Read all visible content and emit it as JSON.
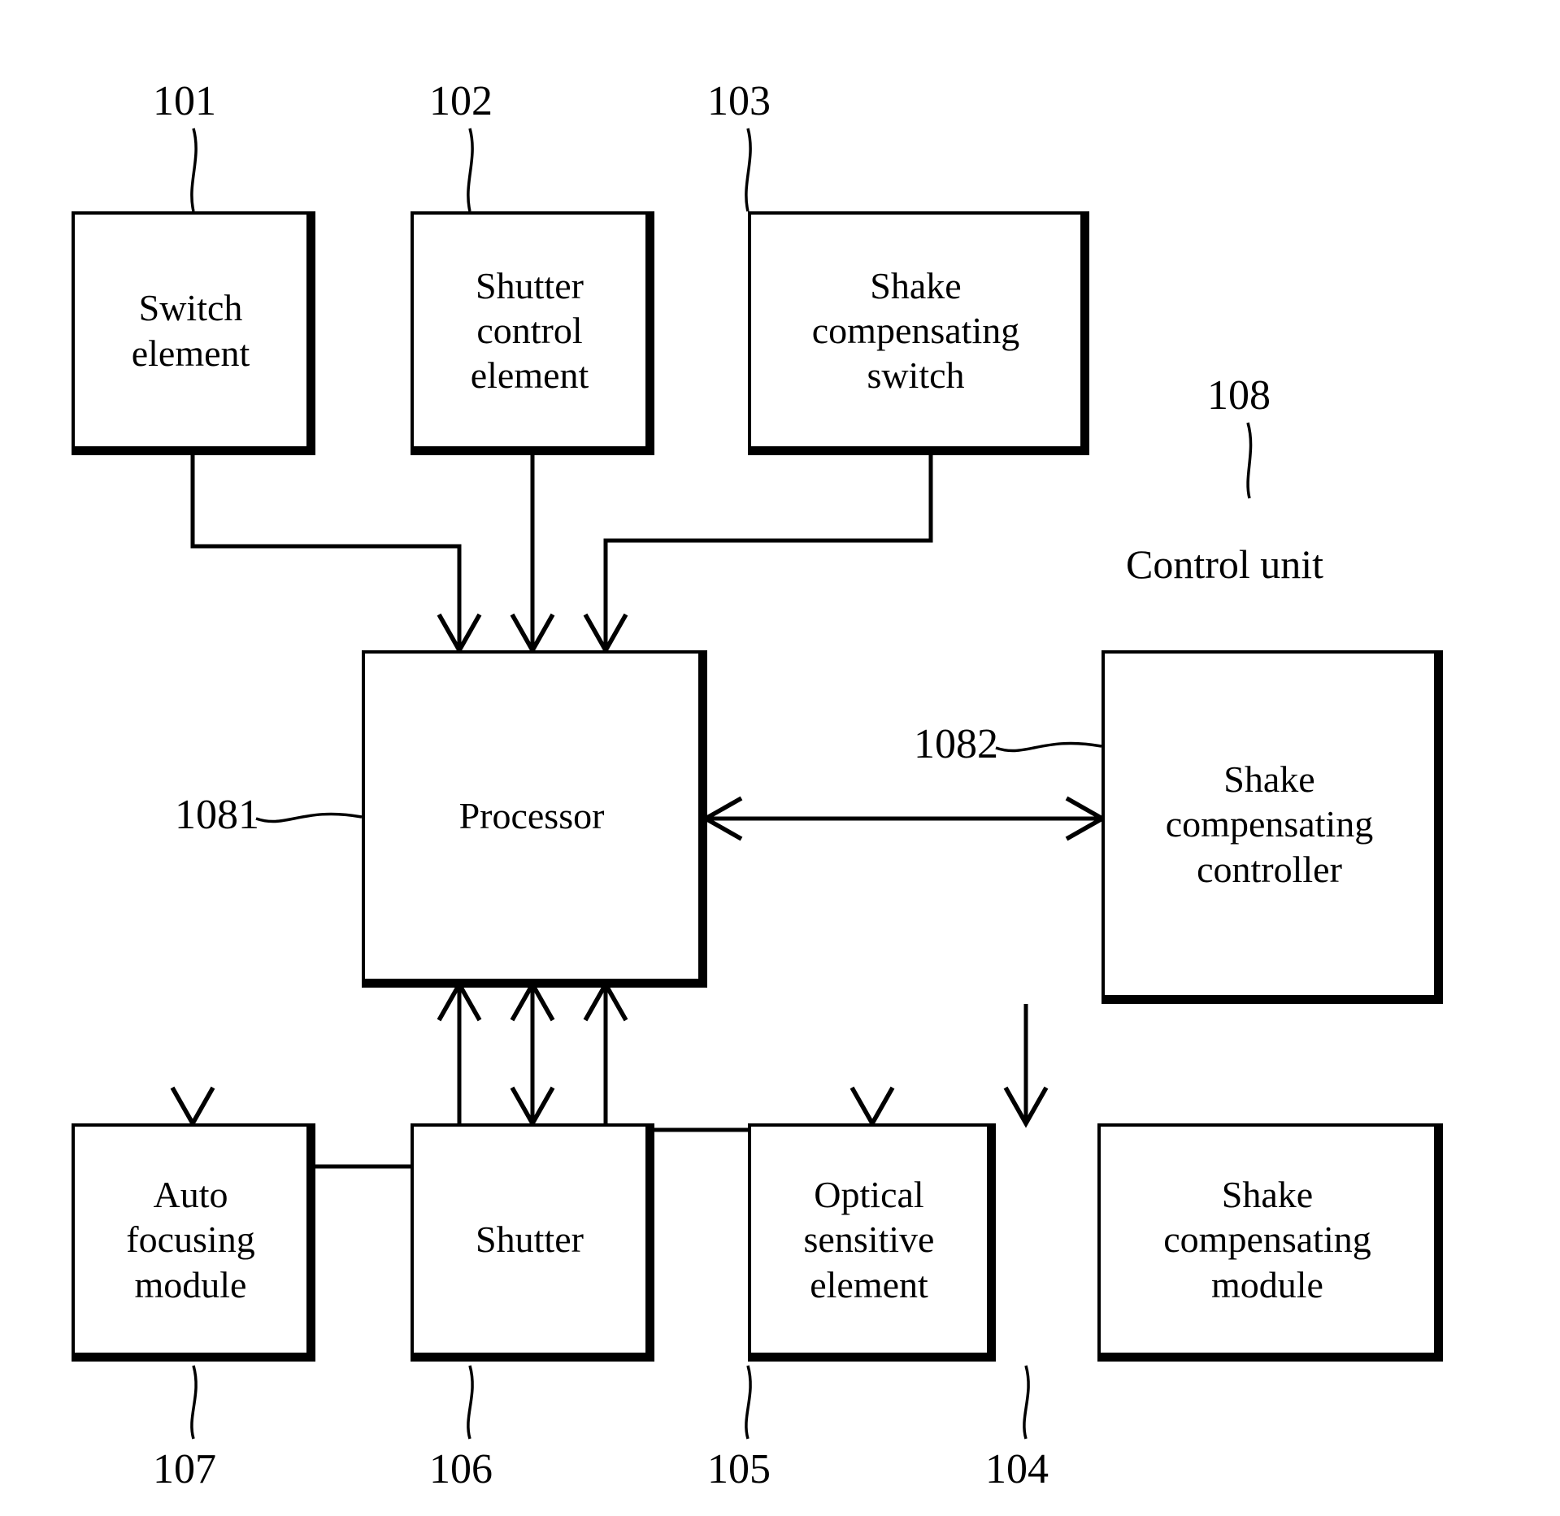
{
  "figure": {
    "type": "patent-block-diagram",
    "title": "Camera control block diagram"
  },
  "blocks": [
    {
      "id": "switch-element",
      "label": "Switch\nelement",
      "ref": "101"
    },
    {
      "id": "shutter-control-element",
      "label": "Shutter\ncontrol\nelement",
      "ref": "102"
    },
    {
      "id": "shake-compensating-switch",
      "label": "Shake\ncompensating\nswitch",
      "ref": "103"
    },
    {
      "id": "processor",
      "label": "Processor",
      "ref": "1081"
    },
    {
      "id": "shake-compensating-controller",
      "label": "Shake\ncompensating\ncontroller",
      "ref": "1082"
    },
    {
      "id": "auto-focusing-module",
      "label": "Auto\nfocusing\nmodule",
      "ref": "107"
    },
    {
      "id": "shutter",
      "label": "Shutter",
      "ref": "106"
    },
    {
      "id": "optical-sensitive-element",
      "label": "Optical\nsensitive\nelement",
      "ref": "105"
    },
    {
      "id": "shake-compensating-module",
      "label": "Shake\ncompensating\nmodule",
      "ref": "104"
    }
  ],
  "control_unit": {
    "label": "Control unit",
    "ref": "108",
    "contains": [
      "processor",
      "shake-compensating-controller"
    ]
  },
  "labels": {
    "switch_element": "Switch\nelement",
    "shutter_control_element": "Shutter\ncontrol\nelement",
    "shake_compensating_switch": "Shake\ncompensating\nswitch",
    "processor": "Processor",
    "shake_compensating_controller": "Shake\ncompensating\ncontroller",
    "auto_focusing_module": "Auto\nfocusing\nmodule",
    "shutter": "Shutter",
    "optical_sensitive_element": "Optical\nsensitive\nelement",
    "shake_compensating_module": "Shake\ncompensating\nmodule",
    "control_unit": "Control unit"
  },
  "refs": {
    "r101": "101",
    "r102": "102",
    "r103": "103",
    "r104": "104",
    "r105": "105",
    "r106": "106",
    "r107": "107",
    "r108": "108",
    "r1081": "1081",
    "r1082": "1082"
  },
  "connections": [
    {
      "from": "switch-element",
      "to": "processor",
      "arrow": "single"
    },
    {
      "from": "shutter-control-element",
      "to": "processor",
      "arrow": "single"
    },
    {
      "from": "shake-compensating-switch",
      "to": "processor",
      "arrow": "single"
    },
    {
      "from": "processor",
      "to": "shake-compensating-controller",
      "arrow": "double"
    },
    {
      "from": "auto-focusing-module",
      "to": "processor",
      "arrow": "double"
    },
    {
      "from": "shutter",
      "to": "processor",
      "arrow": "double"
    },
    {
      "from": "optical-sensitive-element",
      "to": "processor",
      "arrow": "double"
    },
    {
      "from": "shake-compensating-controller",
      "to": "shake-compensating-module",
      "arrow": "single"
    }
  ],
  "colors": {
    "stroke": "#000000",
    "background": "#ffffff"
  }
}
